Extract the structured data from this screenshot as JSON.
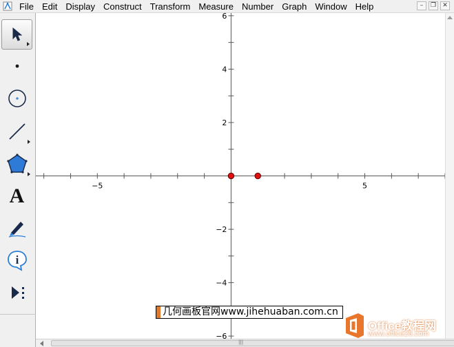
{
  "menu": {
    "items": [
      "File",
      "Edit",
      "Display",
      "Construct",
      "Transform",
      "Measure",
      "Number",
      "Graph",
      "Window",
      "Help"
    ]
  },
  "window_controls": {
    "minimize_icon": "minimize-icon",
    "restore_icon": "restore-icon",
    "close_icon": "close-icon"
  },
  "toolbox": {
    "tools": [
      {
        "name": "selection-arrow-tool",
        "icon": "arrow-pointer-icon",
        "active": true
      },
      {
        "name": "point-tool",
        "icon": "point-icon",
        "active": false
      },
      {
        "name": "compass-tool",
        "icon": "circle-icon",
        "active": false
      },
      {
        "name": "straightedge-tool",
        "icon": "segment-icon",
        "active": false
      },
      {
        "name": "polygon-tool",
        "icon": "pentagon-icon",
        "active": false
      },
      {
        "name": "text-tool",
        "icon": "text-a-icon",
        "active": false
      },
      {
        "name": "marker-tool",
        "icon": "pen-icon",
        "active": false
      },
      {
        "name": "information-tool",
        "icon": "info-icon",
        "active": false
      },
      {
        "name": "custom-tool",
        "icon": "play-more-icon",
        "active": false
      }
    ],
    "text_tool_glyph": "A"
  },
  "graph": {
    "x_ticks": [
      -5,
      5
    ],
    "y_ticks": [
      6,
      4,
      2,
      -2,
      -4,
      -6
    ],
    "x_tick_labels": [
      "−5",
      "5"
    ],
    "y_tick_labels": [
      "6",
      "4",
      "2",
      "−2",
      "−4",
      "−6"
    ],
    "xlim": [
      -7.3,
      8.0
    ],
    "ylim": [
      -6.1,
      6.1
    ],
    "minor_step": 1,
    "points": [
      {
        "x": 0,
        "y": 0,
        "color": "#e01010"
      },
      {
        "x": 1,
        "y": 0,
        "color": "#e01010"
      }
    ],
    "axis_color": "#555555"
  },
  "watermark": {
    "text": "几何画板官网www.jihehuaban.com.cn",
    "office_name": "Office教程网",
    "office_url": "www.office26.com",
    "accent": "#e8762c"
  }
}
